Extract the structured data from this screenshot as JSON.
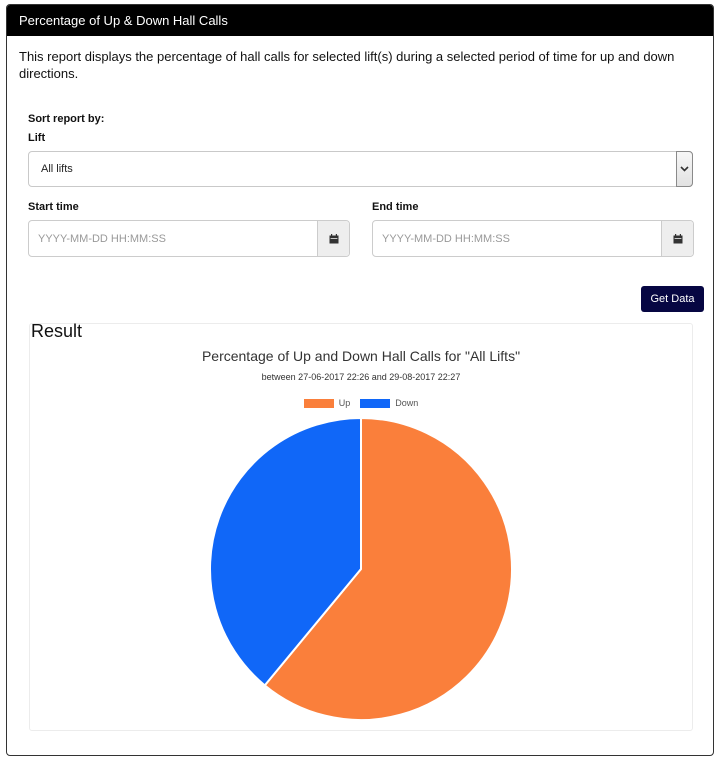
{
  "header": {
    "title": "Percentage of Up & Down Hall Calls"
  },
  "description": "This report displays the percentage of hall calls for selected lift(s) during a selected period of time for up and down directions.",
  "form": {
    "sort_label": "Sort report by:",
    "lift_label": "Lift",
    "lift_selected": "All lifts",
    "start_label": "Start time",
    "start_placeholder": "YYYY-MM-DD HH:MM:SS",
    "end_label": "End time",
    "end_placeholder": "YYYY-MM-DD HH:MM:SS",
    "get_data_label": "Get Data"
  },
  "result": {
    "title": "Result"
  },
  "chart_data": {
    "type": "pie",
    "title": "Percentage of Up and Down Hall Calls for \"All Lifts\"",
    "subtitle": "between 27-06-2017 22:26 and 29-08-2017 22:27",
    "legend_position": "top",
    "categories": [
      "Up",
      "Down"
    ],
    "values": [
      61,
      39
    ],
    "colors": [
      "#fa7f3b",
      "#1067f8"
    ]
  }
}
